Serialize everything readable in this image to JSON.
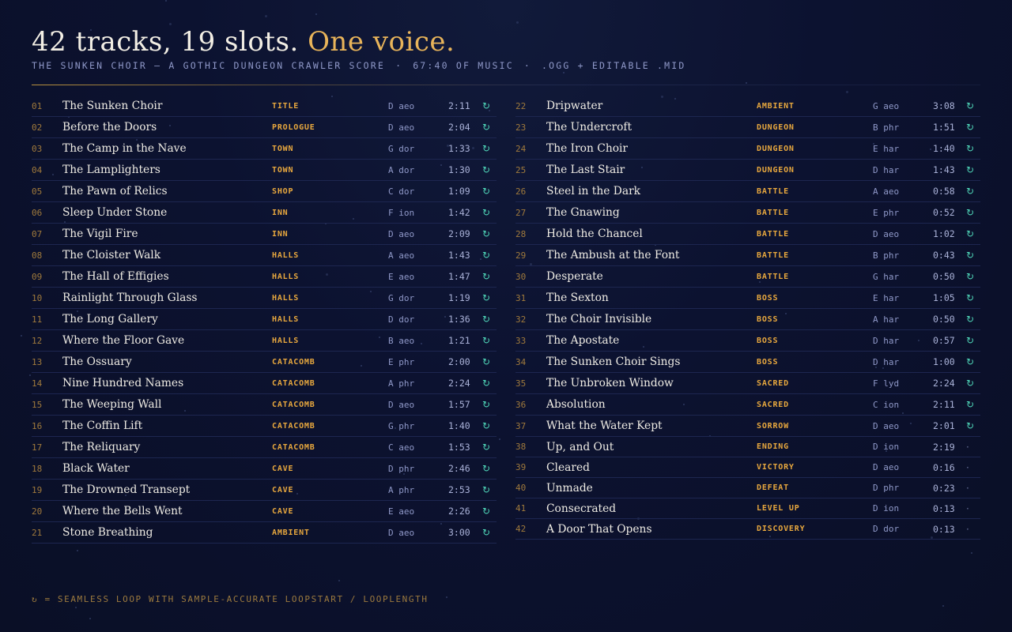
{
  "header": {
    "title_main": "42 tracks, 19 slots. ",
    "title_accent": "One voice.",
    "subtitle_parts": [
      "THE SUNKEN CHOIR — A GOTHIC DUNGEON CRAWLER SCORE",
      "67:40 OF MUSIC",
      ".OGG + EDITABLE .MID"
    ],
    "subtitle_separator": "·"
  },
  "colors": {
    "accent": "#e8b45a",
    "tag": "#e8a83e",
    "loop": "#4fd6b8",
    "muted": "#8f98c8",
    "background": "#0c1230"
  },
  "icons": {
    "loop": "refresh-loop-icon",
    "no_loop": "dot-icon"
  },
  "tracks_left": [
    {
      "num": "01",
      "name": "The Sunken Choir",
      "tag": "TITLE",
      "key": "D aeo",
      "dur": "2:11",
      "loop": "↻"
    },
    {
      "num": "02",
      "name": "Before the Doors",
      "tag": "PROLOGUE",
      "key": "D aeo",
      "dur": "2:04",
      "loop": "↻"
    },
    {
      "num": "03",
      "name": "The Camp in the Nave",
      "tag": "TOWN",
      "key": "G dor",
      "dur": "1:33",
      "loop": "↻"
    },
    {
      "num": "04",
      "name": "The Lamplighters",
      "tag": "TOWN",
      "key": "A dor",
      "dur": "1:30",
      "loop": "↻"
    },
    {
      "num": "05",
      "name": "The Pawn of Relics",
      "tag": "SHOP",
      "key": "C dor",
      "dur": "1:09",
      "loop": "↻"
    },
    {
      "num": "06",
      "name": "Sleep Under Stone",
      "tag": "INN",
      "key": "F ion",
      "dur": "1:42",
      "loop": "↻"
    },
    {
      "num": "07",
      "name": "The Vigil Fire",
      "tag": "INN",
      "key": "D aeo",
      "dur": "2:09",
      "loop": "↻"
    },
    {
      "num": "08",
      "name": "The Cloister Walk",
      "tag": "HALLS",
      "key": "A aeo",
      "dur": "1:43",
      "loop": "↻"
    },
    {
      "num": "09",
      "name": "The Hall of Effigies",
      "tag": "HALLS",
      "key": "E aeo",
      "dur": "1:47",
      "loop": "↻"
    },
    {
      "num": "10",
      "name": "Rainlight Through Glass",
      "tag": "HALLS",
      "key": "G dor",
      "dur": "1:19",
      "loop": "↻"
    },
    {
      "num": "11",
      "name": "The Long Gallery",
      "tag": "HALLS",
      "key": "D dor",
      "dur": "1:36",
      "loop": "↻"
    },
    {
      "num": "12",
      "name": "Where the Floor Gave",
      "tag": "HALLS",
      "key": "B aeo",
      "dur": "1:21",
      "loop": "↻"
    },
    {
      "num": "13",
      "name": "The Ossuary",
      "tag": "CATACOMB",
      "key": "E phr",
      "dur": "2:00",
      "loop": "↻"
    },
    {
      "num": "14",
      "name": "Nine Hundred Names",
      "tag": "CATACOMB",
      "key": "A phr",
      "dur": "2:24",
      "loop": "↻"
    },
    {
      "num": "15",
      "name": "The Weeping Wall",
      "tag": "CATACOMB",
      "key": "D aeo",
      "dur": "1:57",
      "loop": "↻"
    },
    {
      "num": "16",
      "name": "The Coffin Lift",
      "tag": "CATACOMB",
      "key": "G phr",
      "dur": "1:40",
      "loop": "↻"
    },
    {
      "num": "17",
      "name": "The Reliquary",
      "tag": "CATACOMB",
      "key": "C aeo",
      "dur": "1:53",
      "loop": "↻"
    },
    {
      "num": "18",
      "name": "Black Water",
      "tag": "CAVE",
      "key": "D phr",
      "dur": "2:46",
      "loop": "↻"
    },
    {
      "num": "19",
      "name": "The Drowned Transept",
      "tag": "CAVE",
      "key": "A phr",
      "dur": "2:53",
      "loop": "↻"
    },
    {
      "num": "20",
      "name": "Where the Bells Went",
      "tag": "CAVE",
      "key": "E aeo",
      "dur": "2:26",
      "loop": "↻"
    },
    {
      "num": "21",
      "name": "Stone Breathing",
      "tag": "AMBIENT",
      "key": "D aeo",
      "dur": "3:00",
      "loop": "↻"
    }
  ],
  "tracks_right": [
    {
      "num": "22",
      "name": "Dripwater",
      "tag": "AMBIENT",
      "key": "G aeo",
      "dur": "3:08",
      "loop": "↻"
    },
    {
      "num": "23",
      "name": "The Undercroft",
      "tag": "DUNGEON",
      "key": "B phr",
      "dur": "1:51",
      "loop": "↻"
    },
    {
      "num": "24",
      "name": "The Iron Choir",
      "tag": "DUNGEON",
      "key": "E har",
      "dur": "1:40",
      "loop": "↻"
    },
    {
      "num": "25",
      "name": "The Last Stair",
      "tag": "DUNGEON",
      "key": "D har",
      "dur": "1:43",
      "loop": "↻"
    },
    {
      "num": "26",
      "name": "Steel in the Dark",
      "tag": "BATTLE",
      "key": "A aeo",
      "dur": "0:58",
      "loop": "↻"
    },
    {
      "num": "27",
      "name": "The Gnawing",
      "tag": "BATTLE",
      "key": "E phr",
      "dur": "0:52",
      "loop": "↻"
    },
    {
      "num": "28",
      "name": "Hold the Chancel",
      "tag": "BATTLE",
      "key": "D aeo",
      "dur": "1:02",
      "loop": "↻"
    },
    {
      "num": "29",
      "name": "The Ambush at the Font",
      "tag": "BATTLE",
      "key": "B phr",
      "dur": "0:43",
      "loop": "↻"
    },
    {
      "num": "30",
      "name": "Desperate",
      "tag": "BATTLE",
      "key": "G har",
      "dur": "0:50",
      "loop": "↻"
    },
    {
      "num": "31",
      "name": "The Sexton",
      "tag": "BOSS",
      "key": "E har",
      "dur": "1:05",
      "loop": "↻"
    },
    {
      "num": "32",
      "name": "The Choir Invisible",
      "tag": "BOSS",
      "key": "A har",
      "dur": "0:50",
      "loop": "↻"
    },
    {
      "num": "33",
      "name": "The Apostate",
      "tag": "BOSS",
      "key": "D har",
      "dur": "0:57",
      "loop": "↻"
    },
    {
      "num": "34",
      "name": "The Sunken Choir Sings",
      "tag": "BOSS",
      "key": "D har",
      "dur": "1:00",
      "loop": "↻"
    },
    {
      "num": "35",
      "name": "The Unbroken Window",
      "tag": "SACRED",
      "key": "F lyd",
      "dur": "2:24",
      "loop": "↻"
    },
    {
      "num": "36",
      "name": "Absolution",
      "tag": "SACRED",
      "key": "C ion",
      "dur": "2:11",
      "loop": "↻"
    },
    {
      "num": "37",
      "name": "What the Water Kept",
      "tag": "SORROW",
      "key": "D aeo",
      "dur": "2:01",
      "loop": "↻"
    },
    {
      "num": "38",
      "name": "Up, and Out",
      "tag": "ENDING",
      "key": "D ion",
      "dur": "2:19",
      "loop": "·"
    },
    {
      "num": "39",
      "name": "Cleared",
      "tag": "VICTORY",
      "key": "D aeo",
      "dur": "0:16",
      "loop": "·"
    },
    {
      "num": "40",
      "name": "Unmade",
      "tag": "DEFEAT",
      "key": "D phr",
      "dur": "0:23",
      "loop": "·"
    },
    {
      "num": "41",
      "name": "Consecrated",
      "tag": "LEVEL UP",
      "key": "D ion",
      "dur": "0:13",
      "loop": "·"
    },
    {
      "num": "42",
      "name": "A Door That Opens",
      "tag": "DISCOVERY",
      "key": "D dor",
      "dur": "0:13",
      "loop": "·"
    }
  ],
  "footer": {
    "text": "↻ = SEAMLESS LOOP WITH SAMPLE-ACCURATE LOOPSTART / LOOPLENGTH"
  }
}
